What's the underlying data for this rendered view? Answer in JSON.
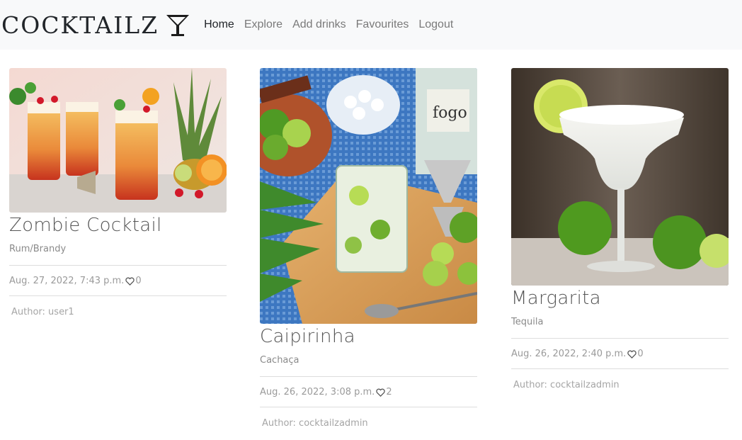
{
  "brand": {
    "name": "COCKTAILZ"
  },
  "nav": {
    "items": [
      {
        "label": "Home",
        "active": true
      },
      {
        "label": "Explore",
        "active": false
      },
      {
        "label": "Add drinks",
        "active": false
      },
      {
        "label": "Favourites",
        "active": false
      },
      {
        "label": "Logout",
        "active": false
      }
    ]
  },
  "cards": [
    {
      "title": "Zombie Cocktail",
      "spirit": "Rum/Brandy",
      "date": "Aug. 27, 2022, 7:43 p.m.",
      "likes": "0",
      "author": "Author: user1"
    },
    {
      "title": "Caipirinha",
      "spirit": "Cachaça",
      "date": "Aug. 26, 2022, 3:08 p.m.",
      "likes": "2",
      "author": "Author: cocktailzadmin",
      "bottle_label": "fogo"
    },
    {
      "title": "Margarita",
      "spirit": "Tequila",
      "date": "Aug. 26, 2022, 2:40 p.m.",
      "likes": "0",
      "author": "Author: cocktailzadmin"
    }
  ],
  "colors": {
    "navbar_bg": "#f8f9fa",
    "nav_active": "#212529",
    "nav_inactive": "#7a7a7a",
    "divider": "#dddddd"
  },
  "icons": {
    "brand": "martini-glass-icon",
    "like": "heart-outline-icon"
  }
}
